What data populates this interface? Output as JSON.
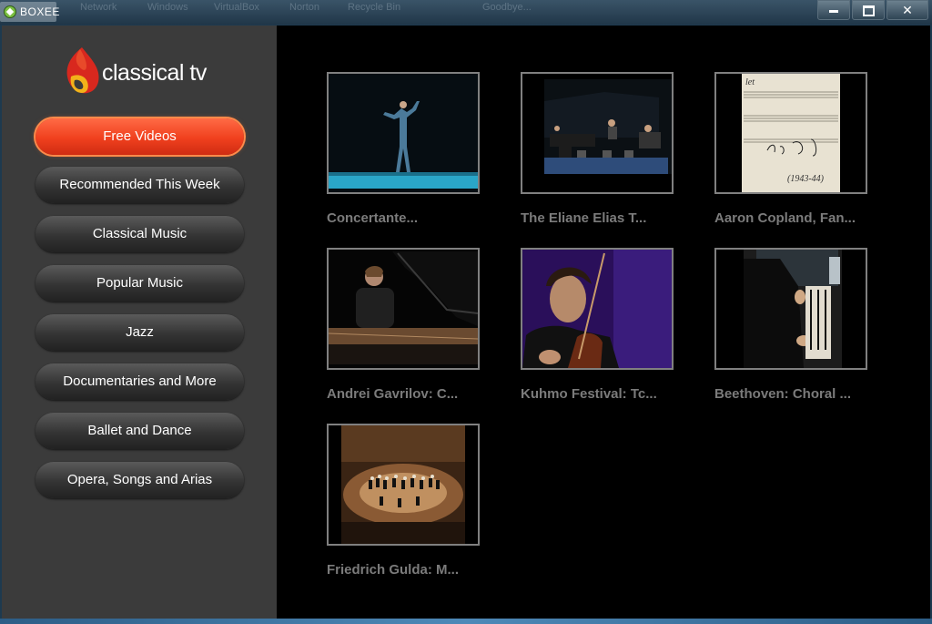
{
  "window": {
    "title": "BOXEE",
    "desktop_labels": [
      "Network",
      "Windows",
      "VirtualBox",
      "Norton",
      "Recycle Bin",
      "Goodbye..."
    ],
    "controls": {
      "minimize": "",
      "maximize": "",
      "close": "✕"
    }
  },
  "sidebar": {
    "logo_text": "classical tv",
    "items": [
      {
        "label": "Free Videos",
        "active": true
      },
      {
        "label": "Recommended This Week",
        "active": false
      },
      {
        "label": "Classical Music",
        "active": false
      },
      {
        "label": "Popular Music",
        "active": false
      },
      {
        "label": "Jazz",
        "active": false
      },
      {
        "label": "Documentaries and More",
        "active": false
      },
      {
        "label": "Ballet and Dance",
        "active": false
      },
      {
        "label": "Opera, Songs and Arias",
        "active": false
      }
    ]
  },
  "videos": [
    {
      "title": "Concertante..."
    },
    {
      "title": "The Eliane Elias T..."
    },
    {
      "title": "Aaron Copland, Fan..."
    },
    {
      "title": "Andrei Gavrilov: C..."
    },
    {
      "title": "Kuhmo Festival: Tc..."
    },
    {
      "title": "Beethoven: Choral ..."
    },
    {
      "title": "Friedrich Gulda: M..."
    }
  ],
  "colors": {
    "accent": "#f0401e",
    "sidebar_bg": "#3b3b3b",
    "content_bg": "#000000",
    "title_text": "#7b7b7b"
  }
}
